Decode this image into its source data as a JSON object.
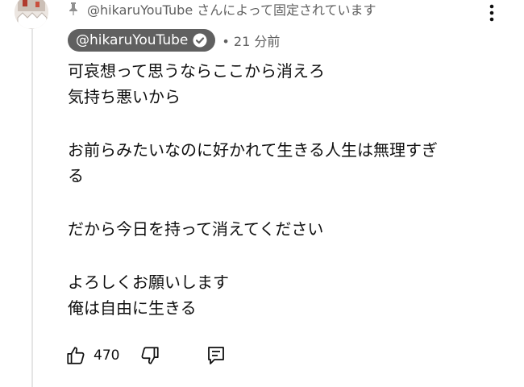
{
  "pinned": {
    "text": "@hikaruYouTube さんによって固定されています",
    "icon": "pin-icon"
  },
  "comment": {
    "author": "@hikaruYouTube",
    "author_badge_icon": "verified-check-icon",
    "timestamp": "• 21 分前",
    "lines": [
      "可哀想って思うならここから消えろ",
      "気持ち悪いから",
      "",
      "お前らみたいなのに好かれて生きる人生は無理すぎ",
      "る",
      "",
      "だから今日を持って消えてください",
      "",
      "よろしくお願いします",
      "俺は自由に生きる"
    ],
    "likes": "470"
  },
  "icons": {
    "more": "more-vertical-icon",
    "like": "thumbs-up-icon",
    "dislike": "thumbs-down-icon",
    "reply": "reply-comment-icon"
  }
}
